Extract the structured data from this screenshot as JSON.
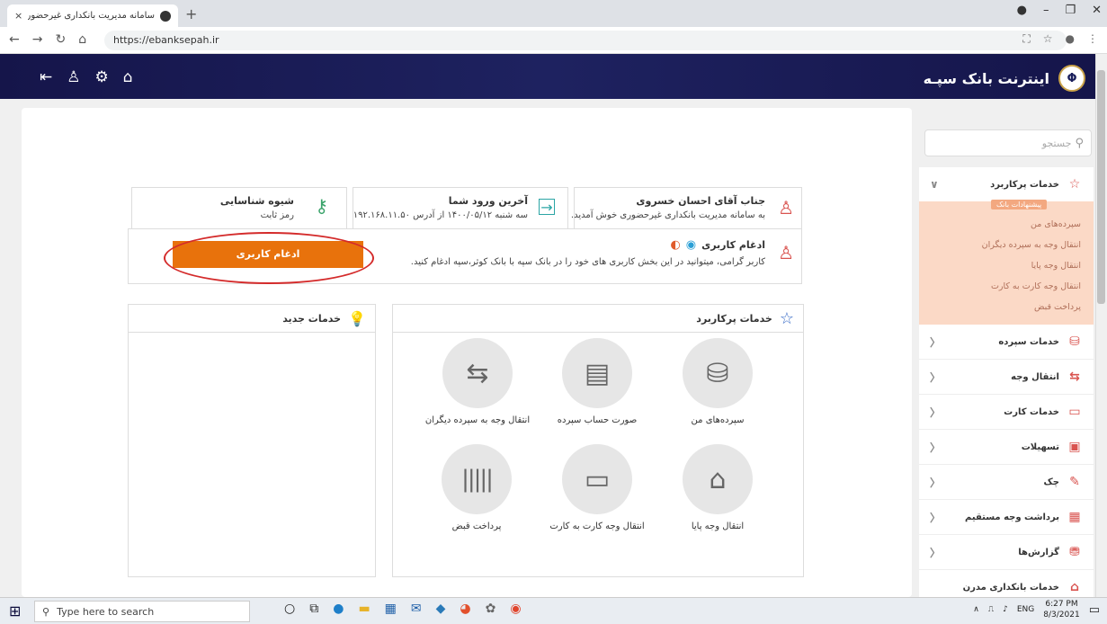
{
  "browser": {
    "tab_title": "سامانه مدیریت بانکداری غیرحضوری",
    "url": "https://ebanksepah.ir",
    "new_tab": "+",
    "close_tab": "×"
  },
  "header": {
    "brand": "اینترنت بانک سپـه"
  },
  "search": {
    "placeholder": "جستجو"
  },
  "welcome": {
    "name": "جناب آقای احسان خسروی",
    "message": "به سامانه مدیریت بانکداری غیرحضوری خوش آمدید."
  },
  "last_login": {
    "title": "آخرین ورود شما",
    "detail": "سه شنبه ۱۴۰۰/۰۵/۱۲ از آدرس ۱۹۲.۱۶۸.۱۱.۵۰"
  },
  "auth_method": {
    "title": "شیوه شناسایی",
    "value": "رمز ثابت"
  },
  "merge": {
    "title": "ادغام کاربری",
    "description": "کاربر گرامی، میتوانید در این بخش کاربری های خود را در بانک سپه با بانک کوثر،سپه ادغام کنید.",
    "button": "ادغام کاربری"
  },
  "popular": {
    "title": "خدمات پرکاربرد",
    "items": [
      {
        "label": "سپرده‌های من",
        "icon": "deposit-search-icon"
      },
      {
        "label": "صورت حساب سپرده",
        "icon": "statement-icon"
      },
      {
        "label": "انتقال وجه به سپرده دیگران",
        "icon": "transfer-deposit-icon"
      },
      {
        "label": "انتقال وجه پایا",
        "icon": "bank-transfer-icon"
      },
      {
        "label": "انتقال وجه کارت به کارت",
        "icon": "card-transfer-icon"
      },
      {
        "label": "پرداخت قبض",
        "icon": "barcode-icon"
      }
    ]
  },
  "new_services": {
    "title": "خدمات جدید"
  },
  "sidebar": {
    "top": {
      "label": "خدمات پرکاربرد"
    },
    "suggest_tag": "پیشنهادات بانک",
    "suggest_items": [
      "سپرده‌های من",
      "انتقال وجه به سپرده دیگران",
      "انتقال وجه پایا",
      "انتقال وجه کارت به کارت",
      "پرداخت قبض"
    ],
    "items": [
      {
        "label": "خدمات سپرده",
        "icon": "deposit-icon"
      },
      {
        "label": "انتقال وجه",
        "icon": "transfer-icon"
      },
      {
        "label": "خدمات کارت",
        "icon": "card-icon"
      },
      {
        "label": "تسهیلات",
        "icon": "loan-icon"
      },
      {
        "label": "چک",
        "icon": "cheque-icon"
      },
      {
        "label": "برداشت وجه مستقیم",
        "icon": "direct-debit-icon"
      },
      {
        "label": "گزارش‌ها",
        "icon": "reports-icon"
      },
      {
        "label": "خدمات بانکداری مدرن",
        "icon": "modern-bank-icon"
      }
    ]
  },
  "taskbar": {
    "search_placeholder": "Type here to search",
    "lang": "ENG",
    "time": "6:27 PM",
    "date": "8/3/2021"
  },
  "colors": {
    "header_bg": "#1a1f5c",
    "merge_button": "#e8720c",
    "suggest_bg": "#fbd9c6",
    "accent_red": "#d9534f"
  }
}
